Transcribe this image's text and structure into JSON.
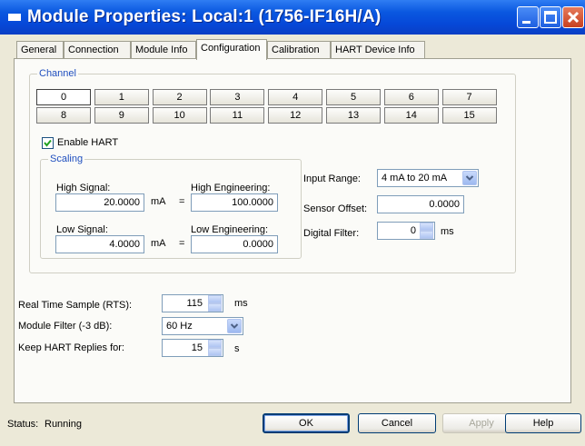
{
  "window": {
    "title": "Module Properties: Local:1 (1756-IF16H/A)"
  },
  "tabs": [
    {
      "label": "General"
    },
    {
      "label": "Connection"
    },
    {
      "label": "Module Info"
    },
    {
      "label": "Configuration",
      "active": true
    },
    {
      "label": "Calibration"
    },
    {
      "label": "HART Device Info"
    }
  ],
  "channel": {
    "label": "Channel",
    "selected": "0",
    "row1": [
      "0",
      "1",
      "2",
      "3",
      "4",
      "5",
      "6",
      "7"
    ],
    "row2": [
      "8",
      "9",
      "10",
      "11",
      "12",
      "13",
      "14",
      "15"
    ]
  },
  "enable_hart": {
    "label": "Enable HART",
    "checked": true
  },
  "scaling": {
    "label": "Scaling",
    "high_signal_label": "High Signal:",
    "high_signal_value": "20.0000",
    "high_unit": "mA",
    "high_eq": "=",
    "high_eng_label": "High Engineering:",
    "high_eng_value": "100.0000",
    "low_signal_label": "Low Signal:",
    "low_signal_value": "4.0000",
    "low_unit": "mA",
    "low_eq": "=",
    "low_eng_label": "Low Engineering:",
    "low_eng_value": "0.0000"
  },
  "input_range": {
    "label": "Input Range:",
    "value": "4 mA to 20 mA"
  },
  "sensor_offset": {
    "label": "Sensor Offset:",
    "value": "0.0000"
  },
  "digital_filter": {
    "label": "Digital Filter:",
    "value": "0",
    "unit": "ms"
  },
  "rts": {
    "label": "Real Time Sample (RTS):",
    "value": "115",
    "unit": "ms"
  },
  "module_filter": {
    "label": "Module Filter (-3 dB):",
    "value": "60 Hz"
  },
  "hart_replies": {
    "label": "Keep HART Replies for:",
    "value": "15",
    "unit": "s"
  },
  "status": {
    "label": "Status:",
    "value": "Running"
  },
  "buttons": {
    "ok": "OK",
    "cancel": "Cancel",
    "apply": "Apply",
    "help": "Help"
  },
  "colors": {
    "titlebar": "#0a58e0",
    "group_label": "#1f4fbf",
    "panel": "#fbfbf8",
    "dialog": "#ece9d8"
  }
}
